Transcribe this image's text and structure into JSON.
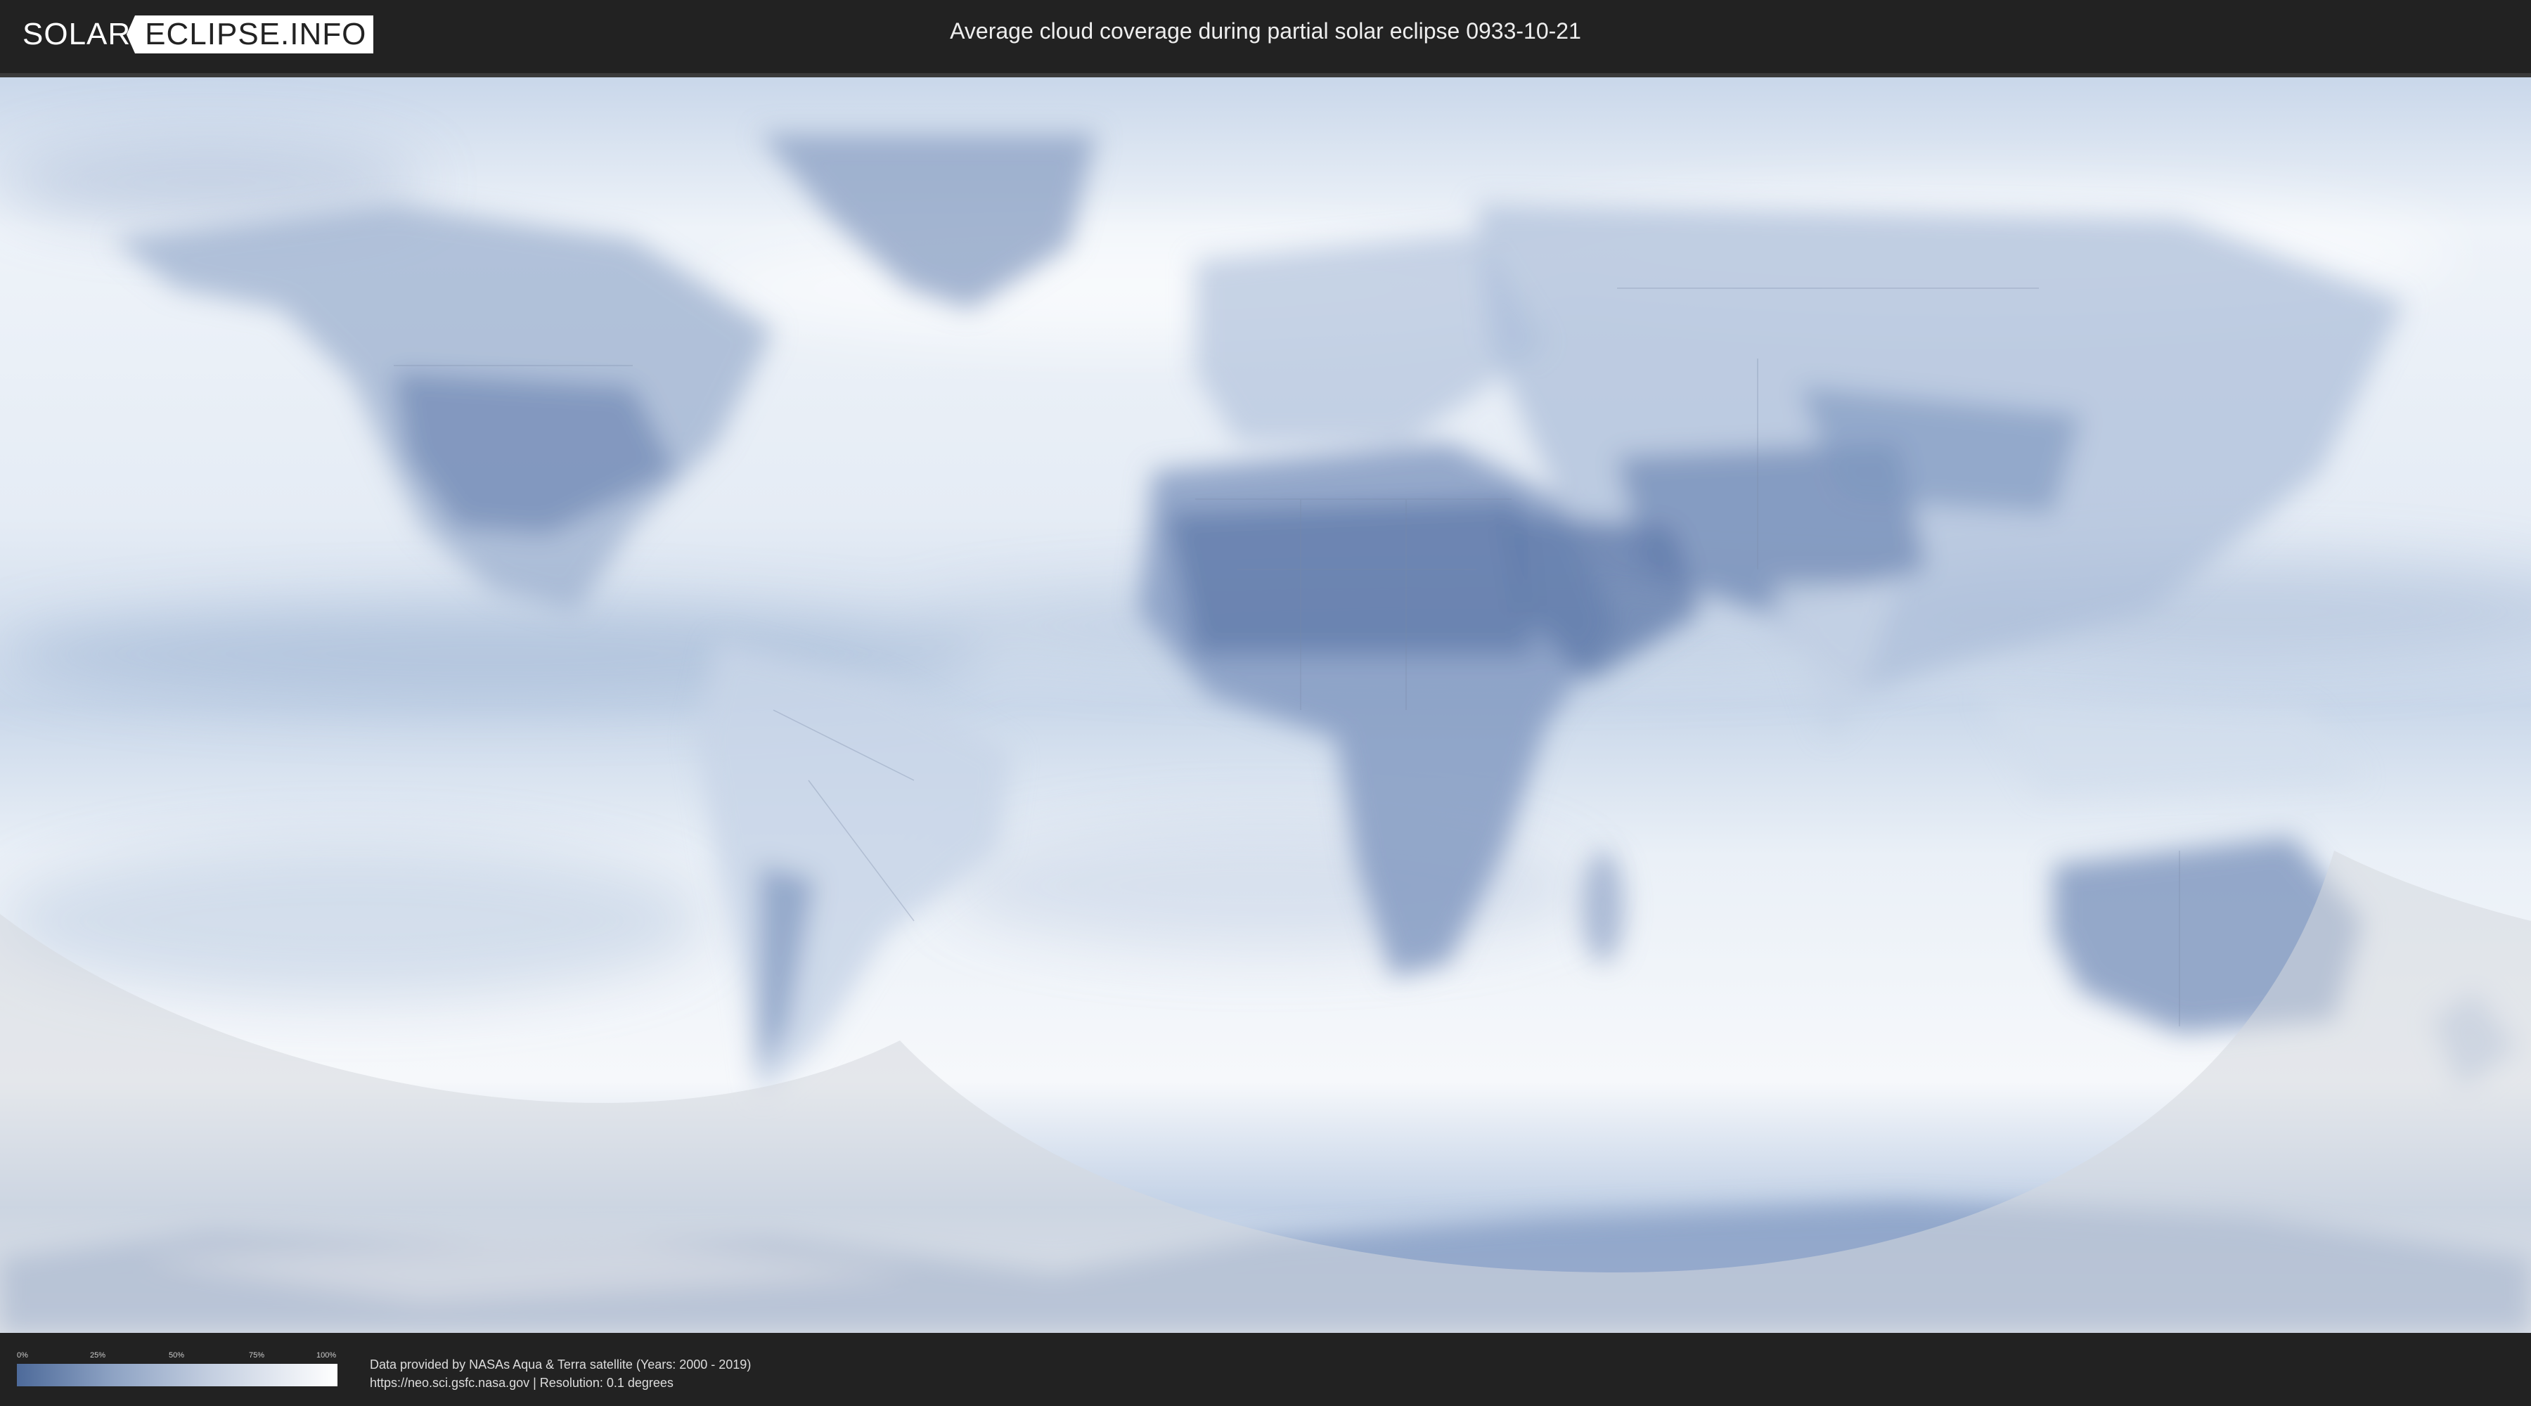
{
  "header": {
    "logo_left": "SOLAR",
    "logo_right": "ECLIPSE.INFO",
    "title": "Average cloud coverage during partial solar eclipse 0933-10-21"
  },
  "map": {
    "description_icon": "world-cloud-coverage-map",
    "colors": {
      "ocean_clear": "#dfe8f3",
      "cloud_dark": "#5877a8",
      "cloud_mid": "#9fb3d1",
      "cloud_light": "#f4f7fb",
      "shadow_overlay": "#d8dbe0"
    }
  },
  "legend": {
    "ticks": [
      "0%",
      "25%",
      "50%",
      "75%",
      "100%"
    ],
    "colors": {
      "start": "#4d6a9a",
      "end": "#ffffff"
    }
  },
  "credits": {
    "line1": "Data provided by NASAs Aqua & Terra satellite (Years: 2000 - 2019)",
    "line2": "https://neo.sci.gsfc.nasa.gov | Resolution: 0.1 degrees"
  }
}
